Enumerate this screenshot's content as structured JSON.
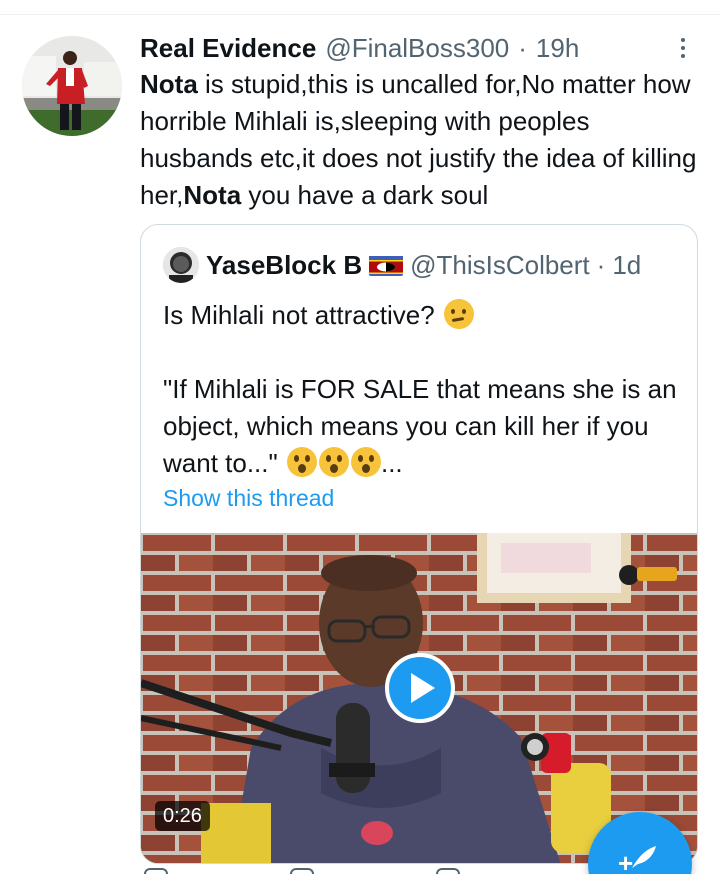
{
  "tweet": {
    "author_name": "Real Evidence",
    "author_handle": "@FinalBoss300",
    "separator": "·",
    "time": "19h",
    "text_parts": [
      {
        "bold": true,
        "text": "Nota"
      },
      {
        "bold": false,
        "text": " is stupid,this is uncalled for,No matter how horrible Mihlali is,sleeping with peoples husbands etc,it does not justify the idea of killing her,"
      },
      {
        "bold": true,
        "text": "Nota"
      },
      {
        "bold": false,
        "text": " you have a dark soul"
      }
    ]
  },
  "quoted_tweet": {
    "author_name": "YaseBlock B",
    "flag_icon": "eswatini-flag-icon",
    "author_handle": "@ThisIsColbert",
    "separator": "·",
    "time": "1d",
    "line1": "Is Mihlali not attractive?",
    "line1_emoji": "thinking-face-emoji",
    "line2": "\"If Mihlali is FOR SALE that means she is an object, which means you can kill her if you want to...\"",
    "line2_emoji": "astonished-face-emoji",
    "line2_suffix": "...",
    "show_thread_label": "Show this thread",
    "video": {
      "duration": "0:26",
      "play_icon": "play-icon"
    }
  },
  "compose": {
    "icon": "compose-tweet-icon",
    "plus": "+"
  },
  "colors": {
    "accent": "#1d9bf0",
    "secondary_text": "#536471",
    "primary_text": "#0f1419",
    "border": "#cfd9de"
  }
}
